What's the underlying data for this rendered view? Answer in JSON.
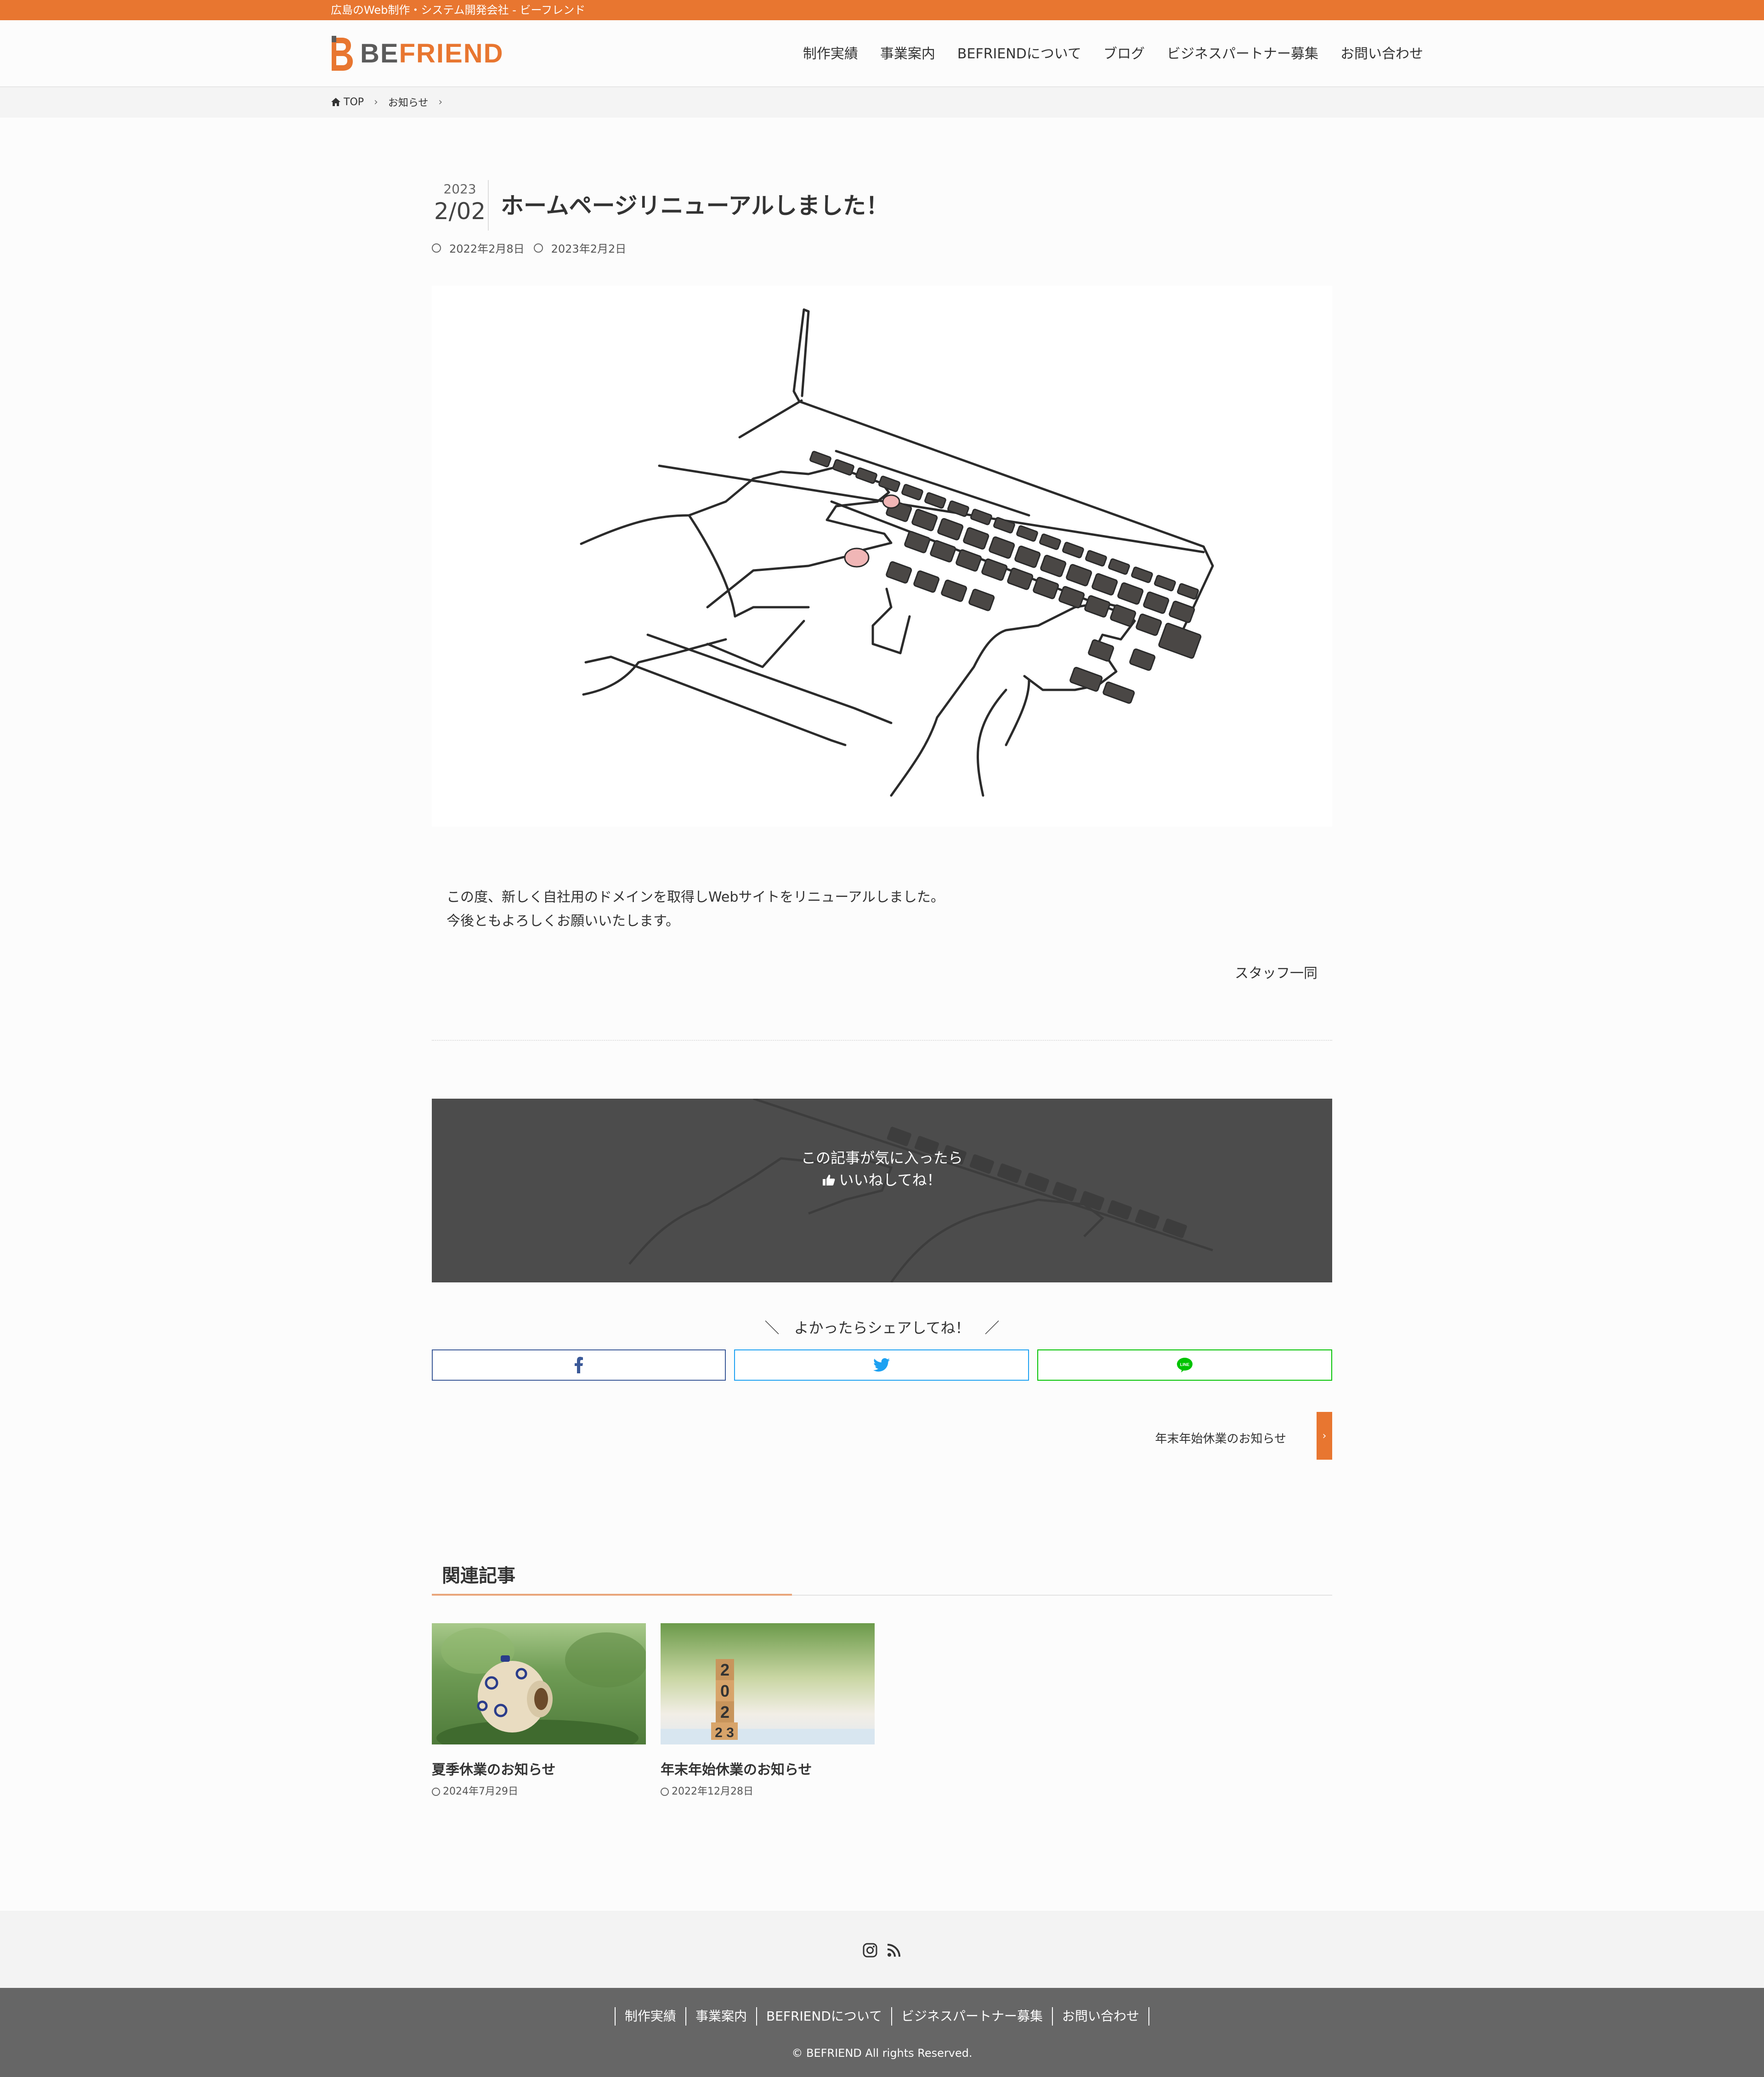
{
  "topbar": {
    "tagline": "広島のWeb制作・システム開発会社 - ビーフレンド",
    "color": "#e87630"
  },
  "header": {
    "logo_text_1": "BE",
    "logo_text_2": "FRIEND",
    "nav": [
      "制作実績",
      "事業案内",
      "BEFRIENDについて",
      "ブログ",
      "ビジネスパートナー募集",
      "お問い合わせ"
    ]
  },
  "breadcrumb": {
    "home": "TOP",
    "category": "お知らせ"
  },
  "article": {
    "date_year": "2023",
    "date_md": "2/02",
    "title": "ホームページリニューアルしました！",
    "published": "2022年2月8日",
    "updated": "2023年2月2日",
    "hero_icon": "laptop-typing-illustration",
    "body_line1": "この度、新しく自社用のドメインを取得しWebサイトをリニューアルしました。",
    "body_line2": "今後ともよろしくお願いいたします。",
    "signature": "スタッフ一同"
  },
  "like": {
    "line1": "この記事が気に入ったら",
    "line2": "いいねしてね！",
    "icon": "thumbs-up-icon"
  },
  "share": {
    "title": "＼　よかったらシェアしてね！　／",
    "buttons": [
      {
        "name": "facebook",
        "icon": "facebook-icon",
        "color": "#3b5998"
      },
      {
        "name": "twitter",
        "icon": "twitter-icon",
        "color": "#1da1f2"
      },
      {
        "name": "line",
        "icon": "line-icon",
        "color": "#00c300"
      }
    ]
  },
  "next_post": {
    "label": "年末年始休業のお知らせ"
  },
  "related": {
    "title": "関連記事",
    "items": [
      {
        "title": "夏季休業のお知らせ",
        "date": "2024年7月29日"
      },
      {
        "title": "年末年始休業のお知らせ",
        "date": "2022年12月28日"
      }
    ]
  },
  "footer": {
    "social_icons": [
      "instagram-icon",
      "rss-icon"
    ],
    "nav": [
      "制作実績",
      "事業案内",
      "BEFRIENDについて",
      "ビジネスパートナー募集",
      "お問い合わせ"
    ],
    "copyright": "© BEFRIEND All rights Reserved."
  }
}
